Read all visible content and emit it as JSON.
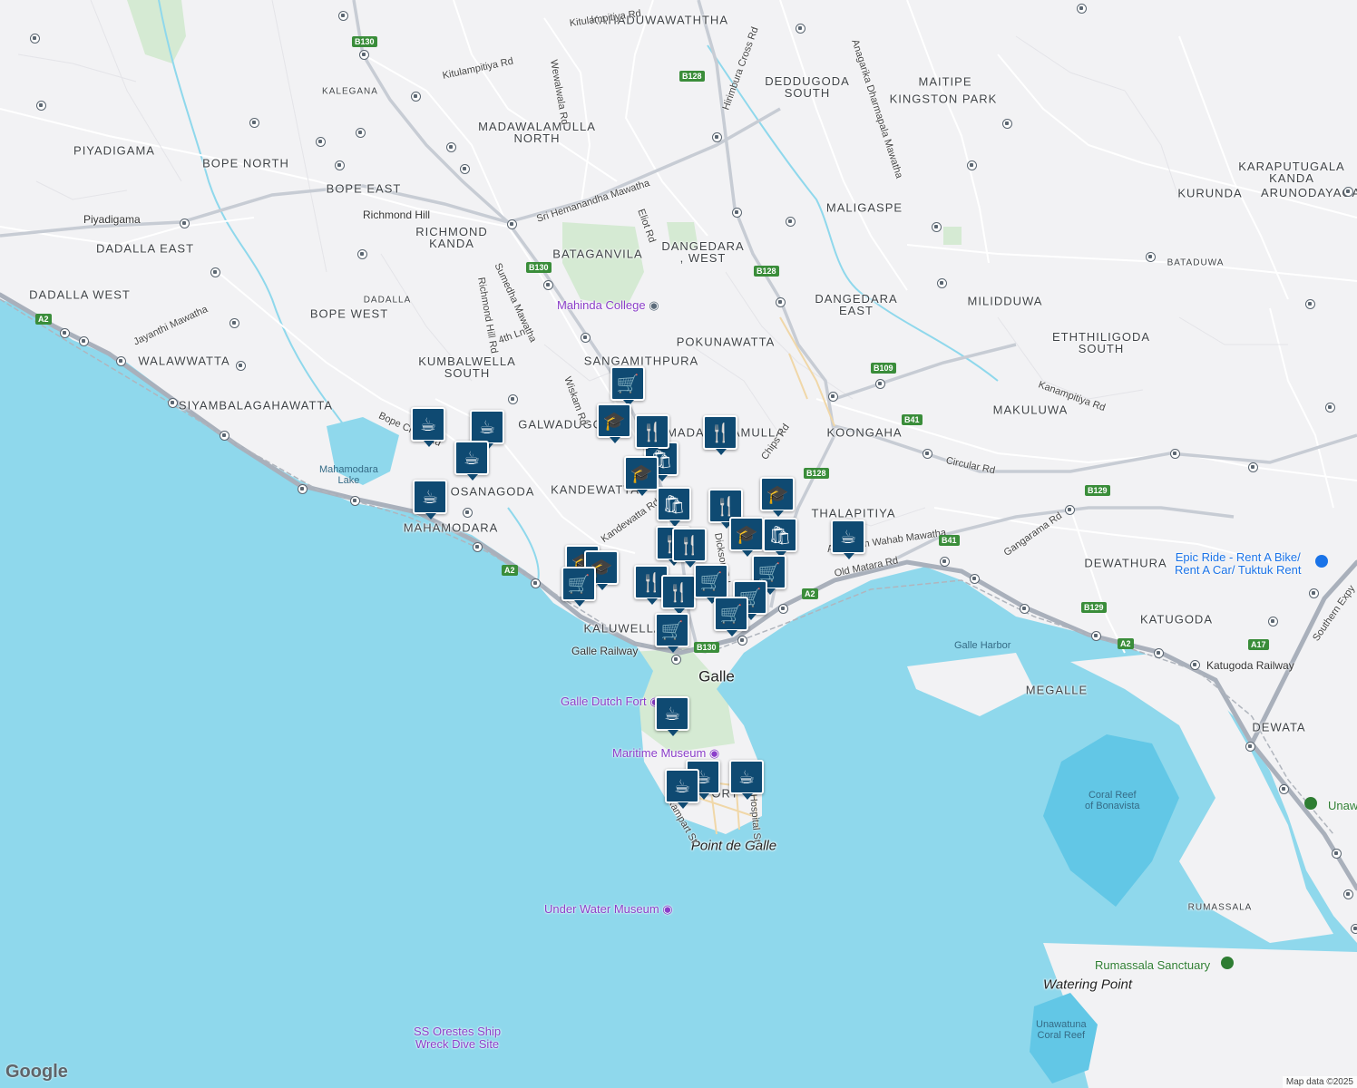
{
  "map": {
    "areas": [
      "KAHADUWAWATHTHA",
      "DEDDUGODA\nSOUTH",
      "MAITIPE",
      "KINGSTON PARK",
      "KALEGANA",
      "MADAWALAMULLA\nNORTH",
      "PIYADIGAMA",
      "BOPE NORTH",
      "BOPE EAST",
      "KARAPUTUGALA\nKANDA",
      "KURUNDA",
      "ARUNODAYAGAM",
      "MALIGASPE",
      "RICHMOND\nKANDA",
      "DADALLA EAST",
      "BATAGANVILA",
      "DANGEDARA\n, WEST",
      "DADALLA WEST",
      "DADALLA",
      "DANGEDARA\nEAST",
      "MILIDDUWA",
      "BATADUWA",
      "BOPE WEST",
      "POKUNAWATTA",
      "ETHTHILIGODA\nSOUTH",
      "WALAWWATTA",
      "KUMBALWELLA\nSOUTH",
      "SANGAMITHPURA",
      "SIYAMBALAGAHAWATTA",
      "MAKULUWA",
      "GALWADUGODA",
      "MADAWALAMULLA",
      "KOONGAHA",
      "OSANAGODA",
      "KANDEWATTA",
      "THALAPITIYA",
      "MAHAMODARA",
      "DEWATHURA",
      "KATUGODA",
      "KALUWELLA",
      "MEGALLE",
      "DEWATA",
      "RUMASSALA",
      "FORT"
    ],
    "towns": [
      "Galle",
      "Point de Galle",
      "Watering Point"
    ],
    "pois": [
      "Mahinda College",
      "Galle Dutch Fort",
      "Maritime Museum",
      "Under Water Museum",
      "SS Orestes Ship\nWreck Dive Site",
      "Rumassala Sanctuary",
      "Epic Ride - Rent A Bike/\nRent A Car/ Tuktuk Rent",
      "Unawatuna"
    ],
    "water_labels": [
      "Mahamodara\nLake",
      "Galle Harbor",
      "Coral Reef\nof Bonavista",
      "Unawatuna\nCoral Reef"
    ],
    "places": [
      "Piyadigama",
      "Richmond Hill",
      "Galle Railway",
      "Katugoda Railway"
    ],
    "roads": [
      "Kitulampitiya Rd",
      "Kitulampitiya Rd",
      "Wewalwala Rd",
      "Hirimbura Cross Rd",
      "Anagarika Dharmapala Mawatha",
      "Sri Hemanandha Mawatha",
      "Eliot Rd",
      "Jayanthi Mawatha",
      "Richmond Hill Rd",
      "Sumedha Mawatha",
      "4th Ln",
      "Wiskam Rd",
      "Bope Cross Rd",
      "Kandewatta Rd",
      "Chips Rd",
      "Dickson Rd",
      "Circular Rd",
      "Kanampitiya Rd",
      "Gangarama Rd",
      "Ahamadh Wahab Mawatha",
      "Old Matara Rd",
      "Hospital St",
      "Rampart St",
      "Southern Expy"
    ],
    "shields": [
      "B130",
      "B128",
      "B128",
      "B130",
      "A2",
      "B109",
      "B41",
      "B128",
      "B41",
      "B129",
      "A2",
      "A2",
      "B129",
      "A2",
      "A17",
      "B130"
    ]
  },
  "markers": [
    "shopping-cart",
    "coffee-cup",
    "coffee-cup",
    "coffee-cup",
    "coffee-cup",
    "school",
    "restaurant",
    "shopping-bag",
    "school",
    "school",
    "shopping-bag",
    "restaurant",
    "school",
    "shopping-bag",
    "coffee-cup",
    "restaurant",
    "restaurant",
    "shopping-cart",
    "school",
    "school",
    "shopping-cart",
    "restaurant",
    "restaurant",
    "shopping-cart",
    "shopping-cart",
    "shopping-cart",
    "shopping-cart",
    "coffee-cup",
    "coffee-cup",
    "coffee-cup",
    "coffee-cup",
    "restaurant"
  ],
  "branding": {
    "logo": "Google",
    "attribution": "Map data ©2025"
  },
  "colors": {
    "water": "#8fd8ec",
    "land": "#f2f2f4",
    "reef": "#62c7e6",
    "park": "#c8e6c9",
    "marker": "#0f4a72",
    "road": "#ffffff",
    "highway": "#a9b0bb"
  }
}
